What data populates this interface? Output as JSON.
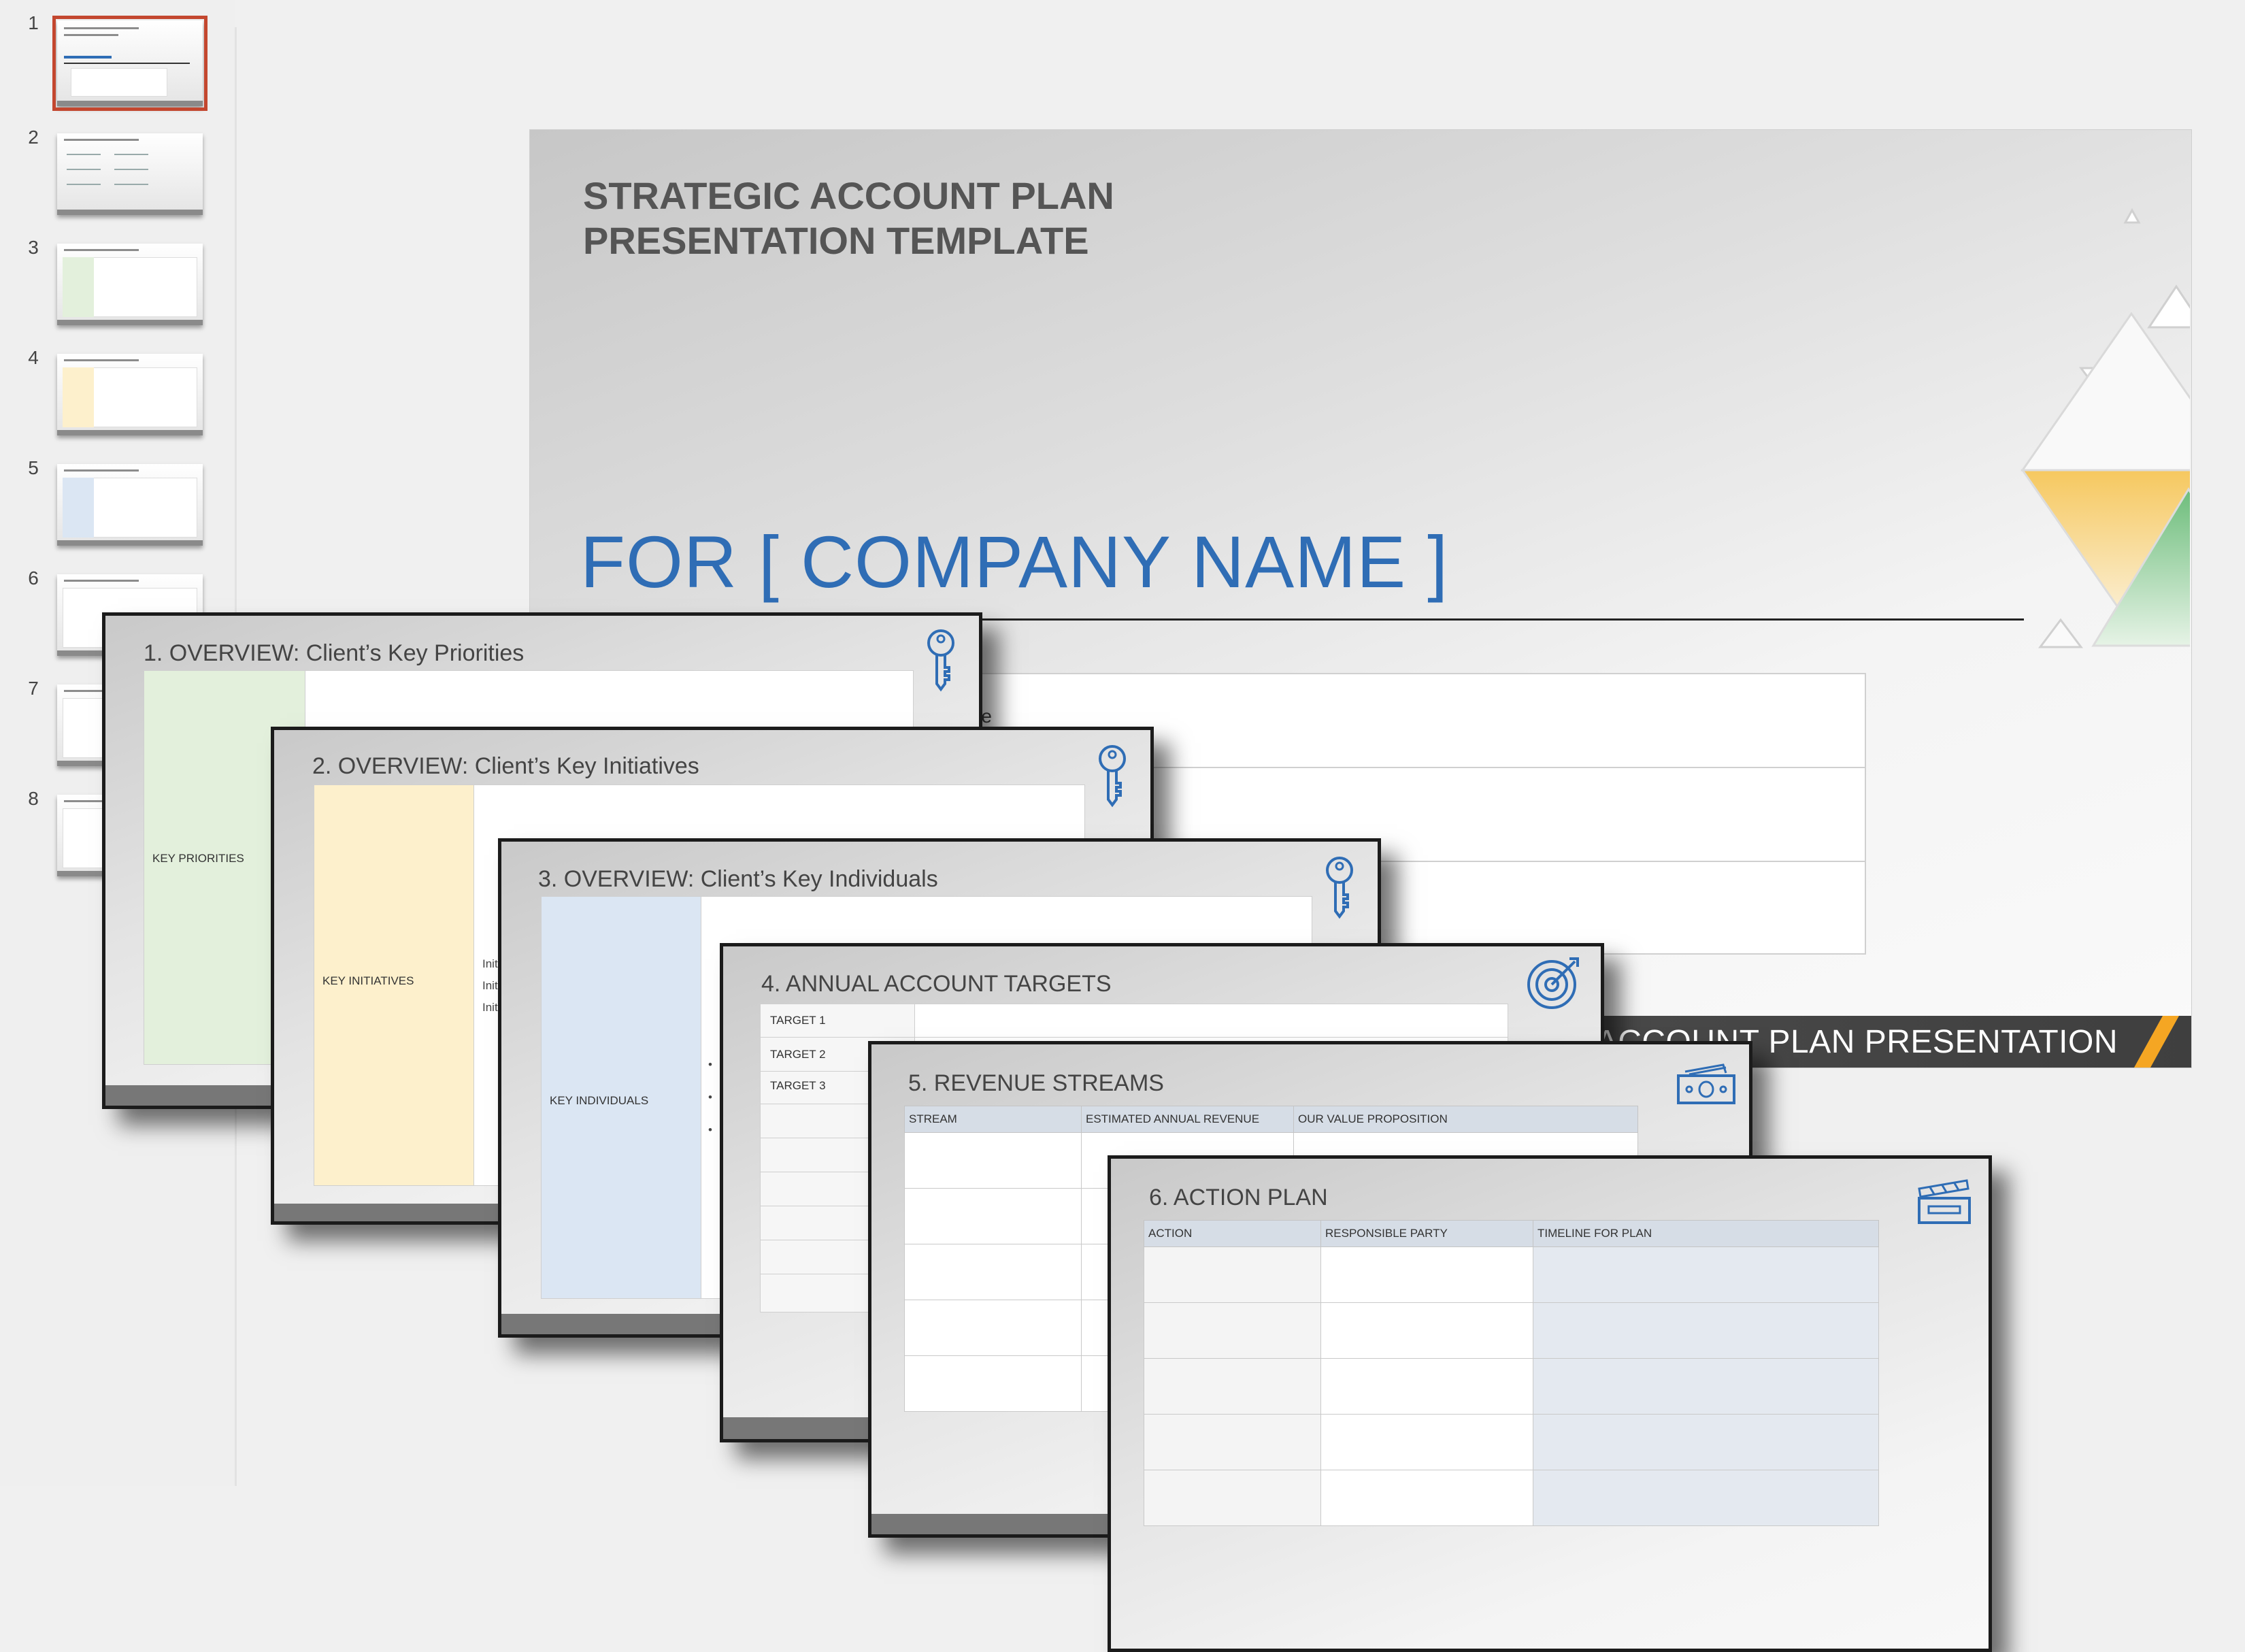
{
  "thumbnails": [
    {
      "number": "1",
      "active": true
    },
    {
      "number": "2",
      "active": false
    },
    {
      "number": "3",
      "active": false
    },
    {
      "number": "4",
      "active": false
    },
    {
      "number": "5",
      "active": false
    },
    {
      "number": "6",
      "active": false
    },
    {
      "number": "7",
      "active": false
    },
    {
      "number": "8",
      "active": false
    }
  ],
  "main_slide": {
    "title_line1": "STRATEGIC ACCOUNT PLAN",
    "title_line2": "PRESENTATION TEMPLATE",
    "company": "FOR [ COMPANY NAME ]",
    "peek_text": "me",
    "footer": "GIC ACCOUNT PLAN PRESENTATION"
  },
  "slides": {
    "s1": {
      "title": "1. OVERVIEW:  Client’s Key Priorities",
      "label": "KEY PRIORITIES",
      "icon": "key-icon"
    },
    "s2": {
      "title": "2. OVERVIEW:  Client’s Key Initiatives",
      "label": "KEY INITIATIVES",
      "icon": "key-icon",
      "bullets": [
        "Initi",
        "Initi",
        "Initi"
      ]
    },
    "s3": {
      "title": "3. OVERVIEW:  Client’s Key Individuals",
      "label": "KEY INDIVIDUALS",
      "icon": "key-icon",
      "bullets": [
        "•",
        "•",
        "•"
      ]
    },
    "s4": {
      "title": "4. ANNUAL ACCOUNT TARGETS",
      "targets": [
        "TARGET 1",
        "TARGET 2",
        "TARGET 3"
      ],
      "icon": "target-icon"
    },
    "s5": {
      "title": "5. REVENUE STREAMS",
      "columns": [
        "STREAM",
        "ESTIMATED ANNUAL REVENUE",
        "OUR VALUE PROPOSITION"
      ],
      "icon": "money-icon"
    },
    "s6": {
      "title": "6. ACTION PLAN",
      "columns": [
        "ACTION",
        "RESPONSIBLE PARTY",
        "TIMELINE FOR PLAN"
      ],
      "icon": "clapperboard-icon"
    }
  },
  "colors": {
    "accent_red": "#c3472f",
    "title_blue": "#2f6db5",
    "green": "#e3f0dc",
    "yellow": "#fdf0cc",
    "blue": "#dbe6f3",
    "header_blue": "#d6dde6",
    "footer_orange": "#f5a623"
  }
}
